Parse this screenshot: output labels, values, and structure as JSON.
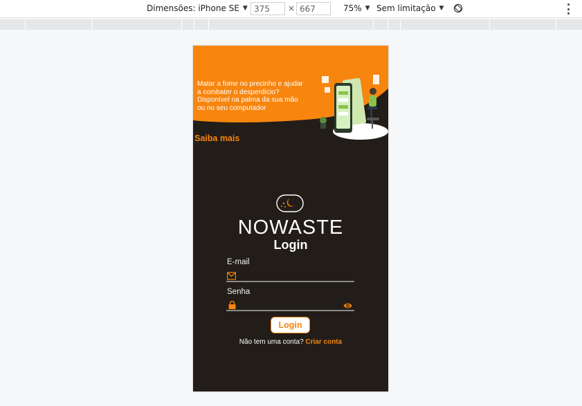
{
  "devtools": {
    "device_label": "Dimensões: iPhone SE",
    "width_value": "375",
    "times": "×",
    "height_value": "667",
    "zoom": "75%",
    "throttle": "Sem limitação",
    "icons": [
      "chevron-down-icon",
      "rotate-icon",
      "more-vert-icon"
    ]
  },
  "hero": {
    "line1": "Matar a fome no precinho e ajudar",
    "line2": "a combater o desperdício?",
    "line3": "Disponível na palma da sua mão",
    "line4": "ou no seu computador",
    "link": "Saiba mais"
  },
  "brand": {
    "name": "NOWASTE"
  },
  "login": {
    "title": "Login",
    "email_label": "E-mail",
    "password_label": "Senha",
    "button": "Login",
    "signup_prompt": "Não tem uma conta?",
    "signup_link": "Criar conta"
  },
  "colors": {
    "accent": "#f7850e",
    "background": "#221d18",
    "text": "#ffffff"
  }
}
